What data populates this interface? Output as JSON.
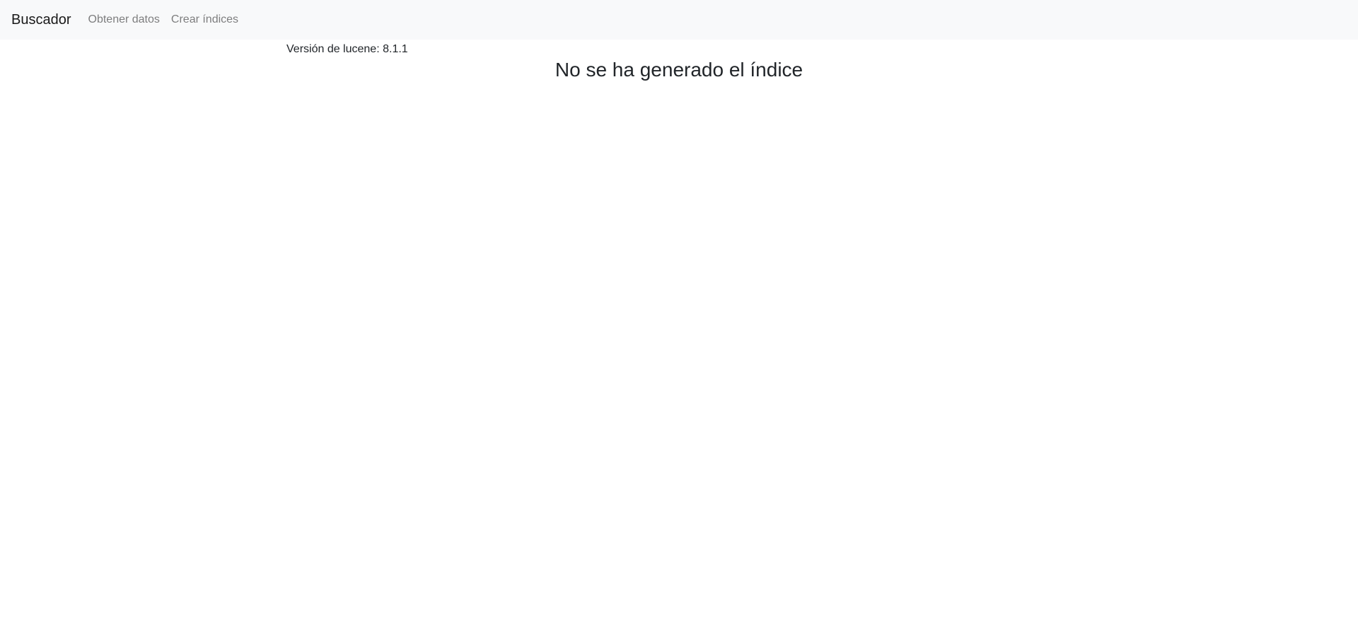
{
  "navbar": {
    "brand": "Buscador",
    "links": [
      {
        "label": "Obtener datos"
      },
      {
        "label": "Crear índices"
      }
    ]
  },
  "main": {
    "version_text": "Versión de lucene: 8.1.1",
    "title": "No se ha generado el índice"
  },
  "colors": {
    "navbar_bg": "#f8f9fa",
    "text": "#212529",
    "nav_link": "#808080"
  }
}
